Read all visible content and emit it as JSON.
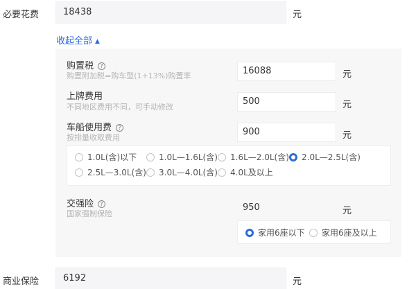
{
  "required": {
    "label": "必要花费",
    "value": "18438",
    "unit": "元"
  },
  "collapse": {
    "label": "收起全部",
    "arrow": "▲"
  },
  "purchase_tax": {
    "title": "购置税",
    "subtitle": "购置附加税=购车型(1+13%)购置率",
    "value": "16088",
    "unit": "元",
    "help_icon": "question-circle-icon"
  },
  "plate_fee": {
    "title": "上牌费用",
    "subtitle": "不同地区费用不同，可手动修改",
    "value": "500",
    "unit": "元"
  },
  "vessel_tax": {
    "title": "车船使用费",
    "subtitle": "按排量收取费用",
    "value": "900",
    "unit": "元",
    "help_icon": "question-circle-icon",
    "options": [
      "1.0L(含)以下",
      "1.0L—1.6L(含)",
      "1.6L—2.0L(含)",
      "2.0L—2.5L(含)",
      "2.5L—3.0L(含)",
      "3.0L—4.0L(含)",
      "4.0L及以上"
    ],
    "selected": "2.0L—2.5L(含)"
  },
  "compulsory_insurance": {
    "title": "交强险",
    "subtitle": "国家强制保险",
    "value": "950",
    "unit": "元",
    "help_icon": "question-circle-icon",
    "options": [
      "家用6座以下",
      "家用6座及以上"
    ],
    "selected": "家用6座以下"
  },
  "commercial": {
    "label": "商业保险",
    "value": "6192",
    "unit": "元"
  },
  "colors": {
    "accent": "#2f6bd8",
    "panel_bg": "#f7f7f8",
    "input_bg": "#f5f5f7"
  }
}
